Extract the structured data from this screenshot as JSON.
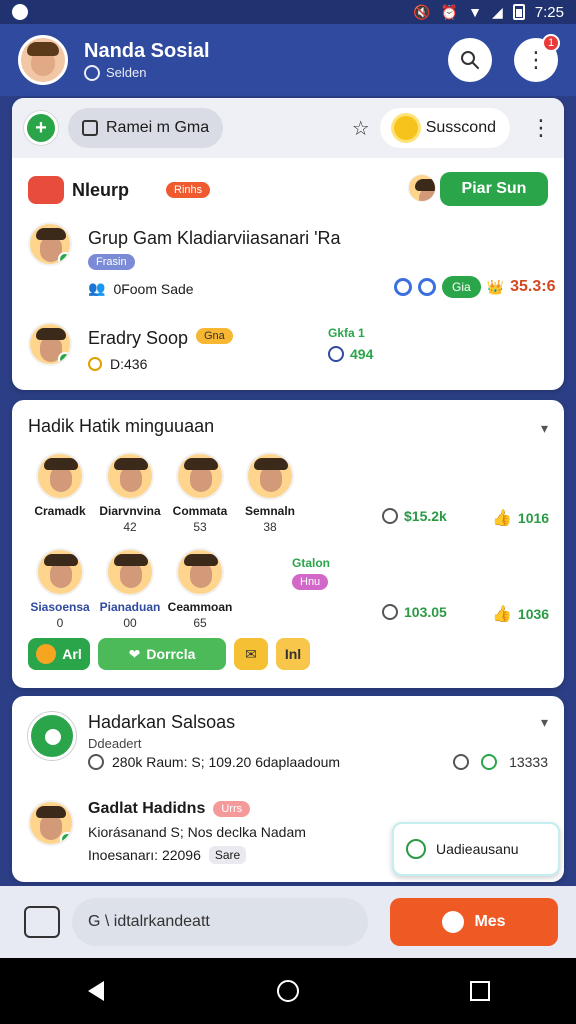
{
  "statusbar": {
    "time": "7:25"
  },
  "appbar": {
    "title": "Nanda Sosial",
    "subtitle": "Selden",
    "notif_count": "1"
  },
  "card1": {
    "toolbar": {
      "pill_label": "Ramei m Gma",
      "right_pill_label": "Susscond"
    },
    "header": {
      "title": "Nleurp",
      "tag": "Rinhs",
      "cta_label": "Piar Sun"
    },
    "row1": {
      "title": "Grup Gam Kladiarviiasanari 'Ra",
      "tag": "Frasin",
      "meta": "0Foom Sade",
      "chip_label": "Gia",
      "value_label": "35.3:6"
    },
    "row2": {
      "title": "Eradry Soop",
      "tag": "Gna",
      "meta": "D:436",
      "small_line1": "Gkfa 1",
      "small_line2": "494"
    }
  },
  "card2": {
    "title": "Hadik Hatik minguuaan",
    "people": [
      {
        "name": "Cramadk",
        "count": ""
      },
      {
        "name": "Diarvnvina",
        "count": "42"
      },
      {
        "name": "Commata",
        "count": "53"
      },
      {
        "name": "Semnaln",
        "count": "38"
      },
      {
        "name": "Siasoensa",
        "count": "0"
      },
      {
        "name": "Pianaduan",
        "count": "00"
      },
      {
        "name": "Ceammoan",
        "count": "65"
      }
    ],
    "metrics": {
      "m1": "$15.2k",
      "m2": "1016",
      "m3": "103.05",
      "m4": "1036"
    },
    "status": {
      "line1": "Gtalon",
      "line2": "Hnu"
    },
    "chips": [
      "Arl",
      "Dorrcla",
      "",
      "Inl"
    ]
  },
  "card3": {
    "title": "Hadarkan Salsoas",
    "subtitle": "Ddeadert",
    "line": "280k Raum:  S; 109.20 6daplaadoum",
    "metrics": [
      "13333"
    ],
    "row2": {
      "name": "Gadlat Hadidns",
      "tag": "Urrs",
      "detail": "Kiorásanand  S;  Nos declka Nadam",
      "sub_left": "Inoesanarı: 22096",
      "sub_tag": "Sare"
    }
  },
  "toast": {
    "label": "Uadieausanu"
  },
  "composer": {
    "placeholder": "G \\ idtalrkandeatt",
    "send_label": "Mes"
  }
}
